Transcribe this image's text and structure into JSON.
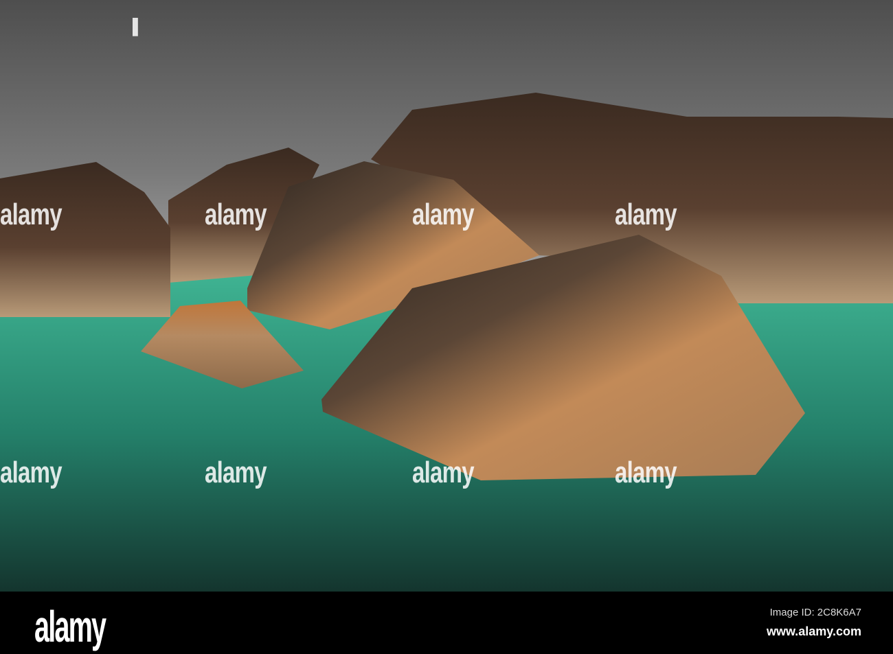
{
  "watermark": {
    "logo_text": "alamy"
  },
  "footer": {
    "logo": "alamy",
    "image_id": "Image ID: 2C8K6A7",
    "website": "www.alamy.com"
  },
  "colors": {
    "sky": "#6a6a6a",
    "water": "#2f9a80",
    "rock_dark": "#3a2c22",
    "rock_light": "#c99a6a",
    "footer_bg": "#000000"
  }
}
